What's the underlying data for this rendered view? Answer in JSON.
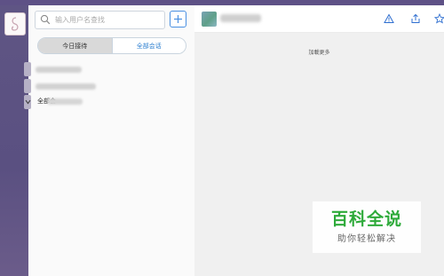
{
  "session_panel": {
    "search": {
      "placeholder": "输入用户名查找"
    },
    "tabs": [
      {
        "label": "今日接待",
        "active": false
      },
      {
        "label": "全部会话",
        "active": true
      }
    ],
    "groups": [
      {
        "expanded": false
      },
      {
        "expanded": false
      },
      {
        "label_prefix": "全部会",
        "expanded": true
      }
    ]
  },
  "chat": {
    "load_more": "加載更多"
  },
  "watermark": {
    "title": "百科全说",
    "subtitle": "助你轻松解决"
  },
  "colors": {
    "rail": "#5e5186",
    "accent": "#2f80d0",
    "watermark_green": "#2eaa3a"
  },
  "icons": [
    "app-logo-icon",
    "search-icon",
    "plus-icon",
    "warning-icon",
    "share-icon",
    "star-icon",
    "chevron-icon"
  ]
}
